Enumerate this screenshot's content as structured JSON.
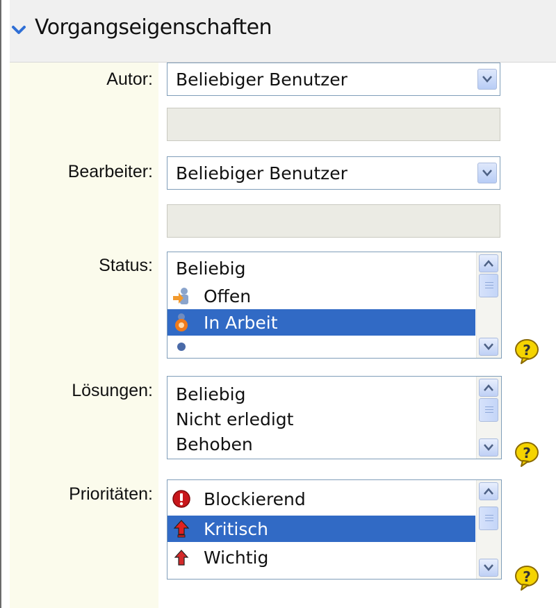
{
  "panel": {
    "title": "Vorgangseigenschaften",
    "toggle_icon": "chevron-down-icon"
  },
  "author": {
    "label": "Autor:",
    "selected": "Beliebiger Benutzer",
    "text_value": ""
  },
  "assignee": {
    "label": "Bearbeiter:",
    "selected": "Beliebiger Benutzer",
    "text_value": ""
  },
  "status": {
    "label": "Status:",
    "items": [
      {
        "label": "Beliebig",
        "icon": "",
        "selected": false
      },
      {
        "label": "Offen",
        "icon": "status-open-icon",
        "selected": false
      },
      {
        "label": "In Arbeit",
        "icon": "status-in-progress-icon",
        "selected": true
      }
    ],
    "help_icon": "help-icon"
  },
  "resolutions": {
    "label": "Lösungen:",
    "items": [
      {
        "label": "Beliebig",
        "selected": false
      },
      {
        "label": "Nicht erledigt",
        "selected": false
      },
      {
        "label": "Behoben",
        "selected": false
      }
    ],
    "help_icon": "help-icon"
  },
  "priorities": {
    "label": "Prioritäten:",
    "items": [
      {
        "label": "Blockierend",
        "icon": "priority-blocker-icon",
        "selected": false
      },
      {
        "label": "Kritisch",
        "icon": "priority-critical-icon",
        "selected": true
      },
      {
        "label": "Wichtig",
        "icon": "priority-major-icon",
        "selected": false
      }
    ],
    "help_icon": "help-icon"
  },
  "colors": {
    "selection": "#316ac5",
    "label_column": "#fbfbec",
    "header": "#f0f0f0"
  }
}
